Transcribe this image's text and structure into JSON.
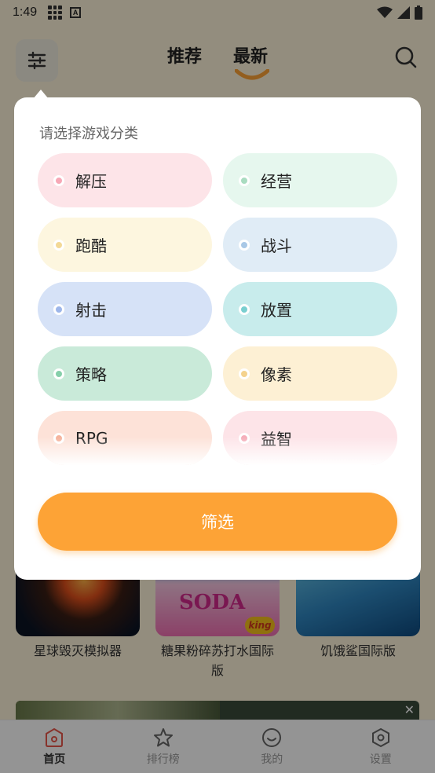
{
  "status_bar": {
    "time": "1:49",
    "a_badge": "A"
  },
  "header": {
    "tabs": [
      {
        "label": "推荐",
        "active": false
      },
      {
        "label": "最新",
        "active": true
      }
    ]
  },
  "game_cards": [
    {
      "title": "星球毁灭模拟器"
    },
    {
      "title": "糖果粉碎苏打水国际版",
      "logo_text": "SODA",
      "badge_text": "king"
    },
    {
      "title": "饥饿鲨国际版"
    }
  ],
  "bottom_nav": [
    {
      "label": "首页",
      "icon": "home-icon",
      "active": true
    },
    {
      "label": "排行榜",
      "icon": "star-icon",
      "active": false
    },
    {
      "label": "我的",
      "icon": "smile-icon",
      "active": false
    },
    {
      "label": "设置",
      "icon": "settings-icon",
      "active": false
    }
  ],
  "popup": {
    "title": "请选择游戏分类",
    "categories": [
      {
        "label": "解压",
        "bg": "#fde4e8",
        "dot": "#f7a8b6"
      },
      {
        "label": "经营",
        "bg": "#e6f7ee",
        "dot": "#a9dcc0"
      },
      {
        "label": "跑酷",
        "bg": "#fdf6df",
        "dot": "#f3d996"
      },
      {
        "label": "战斗",
        "bg": "#e0ecf6",
        "dot": "#a9c8e6"
      },
      {
        "label": "射击",
        "bg": "#d6e2f7",
        "dot": "#9db6ea"
      },
      {
        "label": "放置",
        "bg": "#c8ecec",
        "dot": "#79cfd0"
      },
      {
        "label": "策略",
        "bg": "#c9ead9",
        "dot": "#86cfaa"
      },
      {
        "label": "像素",
        "bg": "#fdf0d4",
        "dot": "#f4d28e"
      },
      {
        "label": "RPG",
        "bg": "#fde2d8",
        "dot": "#f5b39c"
      },
      {
        "label": "益智",
        "bg": "#fde4e8",
        "dot": "#f5aeba"
      }
    ],
    "submit_label": "筛选"
  },
  "colors": {
    "accent": "#fda336",
    "background": "#fdf3d9"
  }
}
